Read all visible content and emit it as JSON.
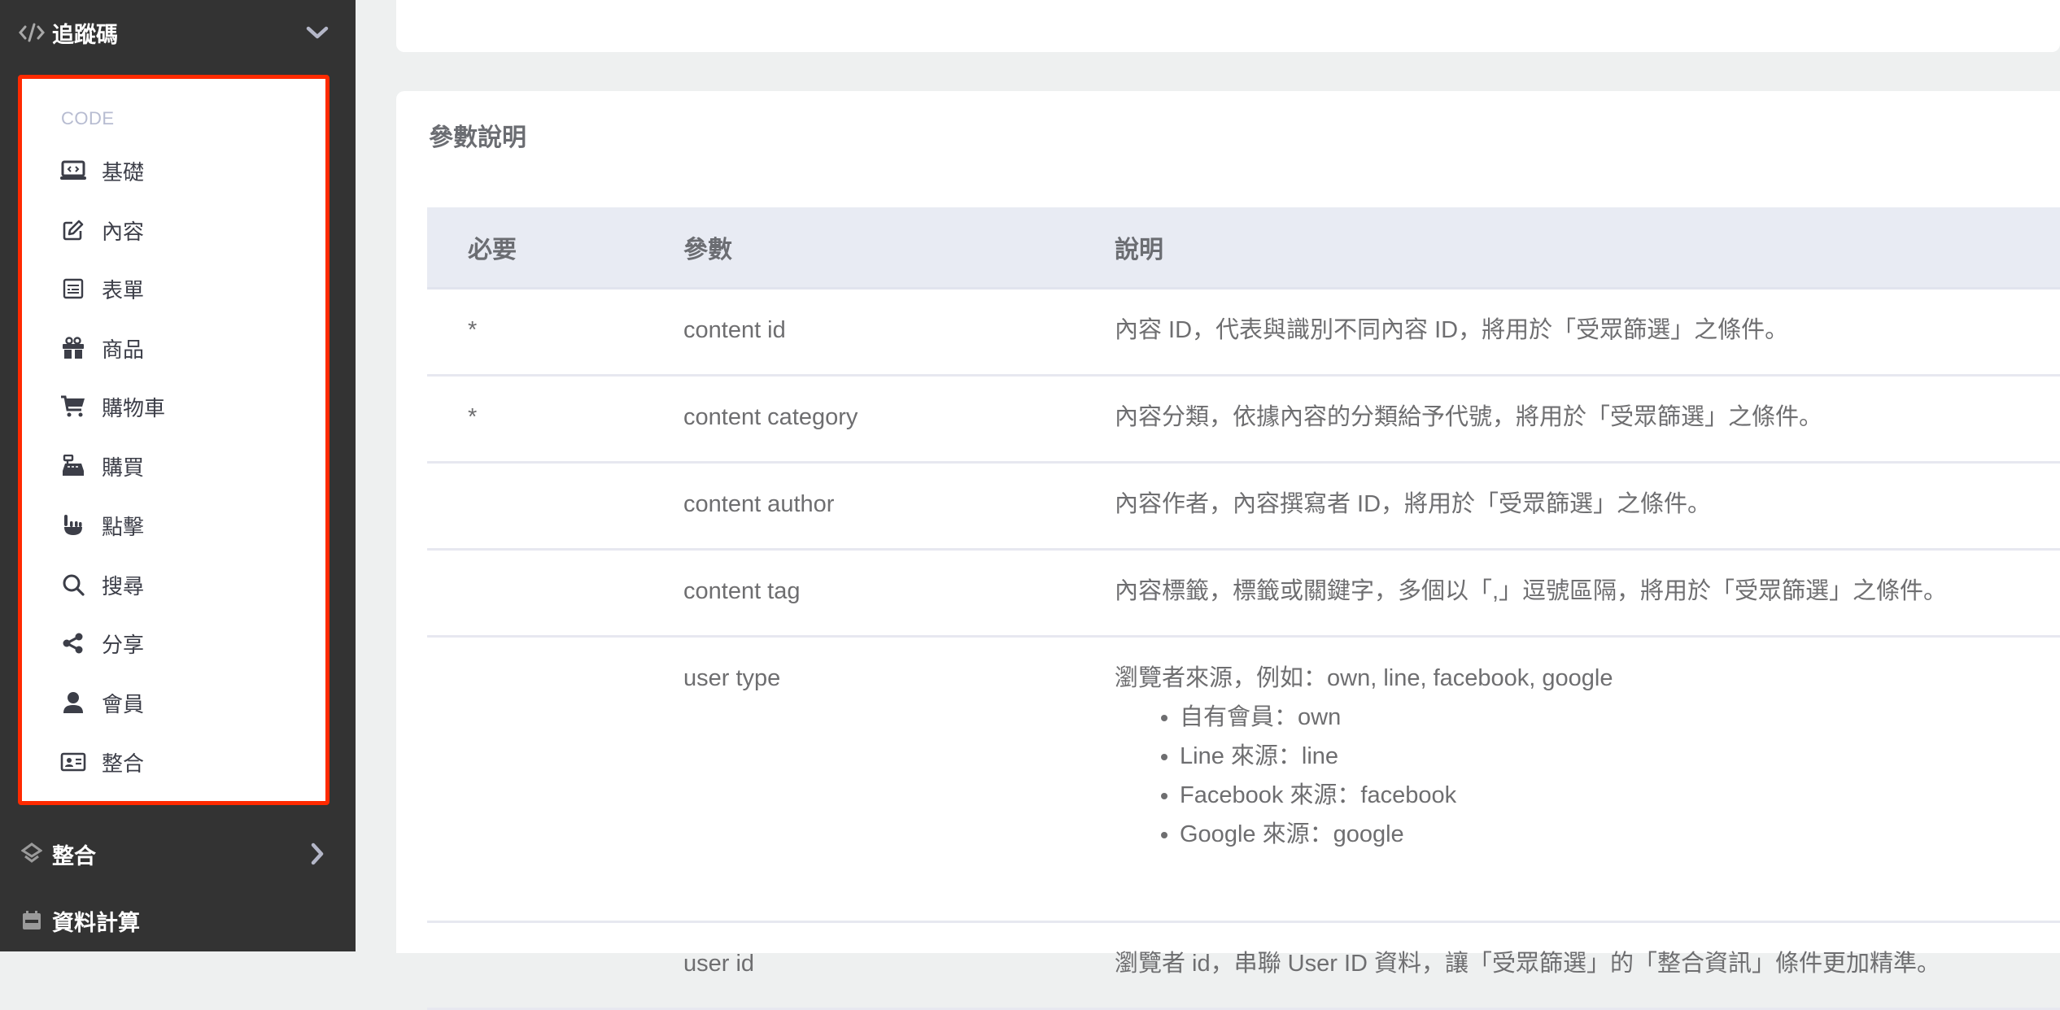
{
  "sidebar": {
    "section_tracking": {
      "label": "追蹤碼",
      "icon": "code-icon",
      "expanded": true
    },
    "submenu": {
      "heading": "CODE",
      "items": [
        {
          "label": "基礎",
          "icon": "laptop-code-icon"
        },
        {
          "label": "內容",
          "icon": "edit-icon"
        },
        {
          "label": "表單",
          "icon": "form-icon"
        },
        {
          "label": "商品",
          "icon": "gift-icon"
        },
        {
          "label": "購物車",
          "icon": "shopping-cart-icon"
        },
        {
          "label": "購買",
          "icon": "cash-register-icon"
        },
        {
          "label": "點擊",
          "icon": "hand-pointer-icon"
        },
        {
          "label": "搜尋",
          "icon": "search-icon"
        },
        {
          "label": "分享",
          "icon": "share-icon"
        },
        {
          "label": "會員",
          "icon": "user-icon"
        },
        {
          "label": "整合",
          "icon": "id-card-icon"
        }
      ]
    },
    "section_integration": {
      "label": "整合",
      "icon": "layers-icon"
    },
    "section_compute": {
      "label": "資料計算",
      "icon": "calendar-icon"
    },
    "highlight_color": "#ff2a00"
  },
  "main": {
    "card_title": "參數說明",
    "table": {
      "headers": [
        "必要",
        "參數",
        "說明"
      ],
      "rows": [
        {
          "required": "*",
          "param": "content id",
          "desc": "內容 ID，代表與識別不同內容 ID，將用於「受眾篩選」之條件。"
        },
        {
          "required": "*",
          "param": "content category",
          "desc": "內容分類，依據內容的分類給予代號，將用於「受眾篩選」之條件。"
        },
        {
          "required": "",
          "param": "content author",
          "desc": "內容作者，內容撰寫者 ID，將用於「受眾篩選」之條件。"
        },
        {
          "required": "",
          "param": "content tag",
          "desc": "內容標籤，標籤或關鍵字，多個以「,」逗號區隔，將用於「受眾篩選」之條件。"
        },
        {
          "required": "",
          "param": "user type",
          "desc": "瀏覽者來源，例如：own, line, facebook, google",
          "bullets": [
            "自有會員：own",
            "Line 來源：line",
            "Facebook 來源：facebook",
            "Google 來源：google"
          ]
        },
        {
          "required": "",
          "param": "user id",
          "desc": "瀏覽者 id，串聯 User ID 資料，讓「受眾篩選」的「整合資訊」條件更加精準。"
        }
      ]
    }
  }
}
